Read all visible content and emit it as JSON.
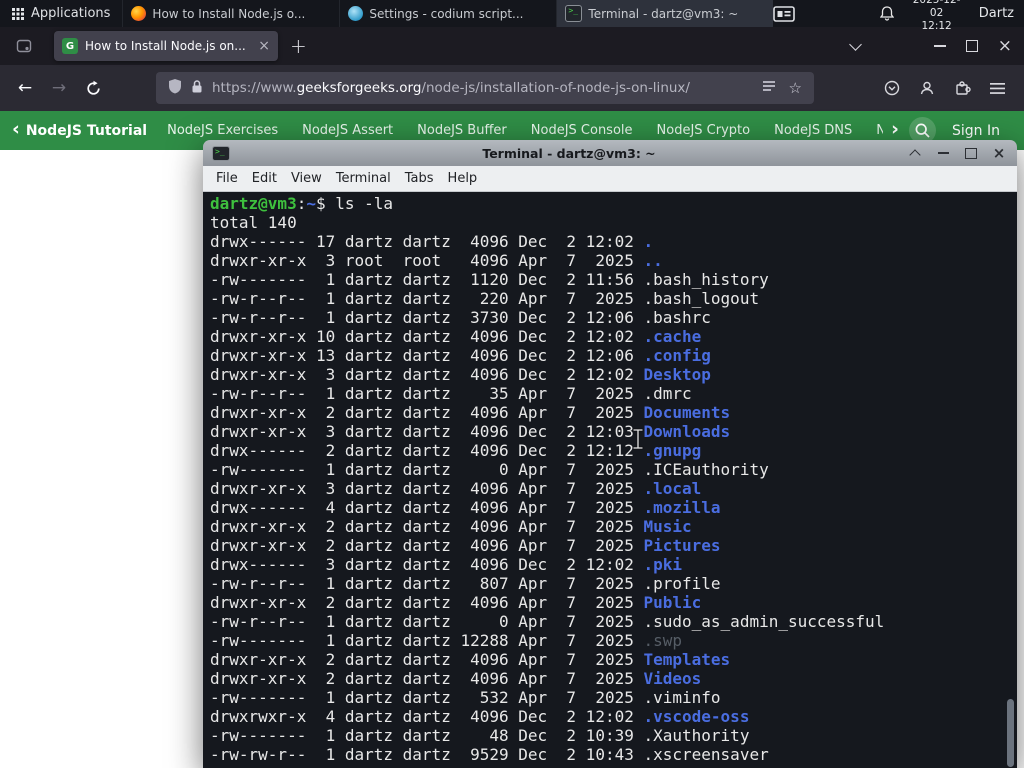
{
  "panel": {
    "applications_label": "Applications",
    "windows": [
      {
        "title": "How to Install Node.js o...",
        "icon": "firefox-icon",
        "active": false
      },
      {
        "title": "Settings - codium script...",
        "icon": "settings-icon",
        "active": false
      },
      {
        "title": "Terminal - dartz@vm3: ~",
        "icon": "terminal-icon",
        "active": true
      }
    ],
    "clock": {
      "date": "2025-12-02",
      "time": "12:12"
    },
    "user_label": "Dartz"
  },
  "glyphs": {
    "back": "←",
    "forward": "→",
    "close": "×",
    "plus": "+",
    "star": "☆",
    "nav_back": "‹",
    "nav_forward": "›",
    "favicon": "G"
  },
  "browser": {
    "tab": {
      "title": "How to Install Node.js on..."
    },
    "urlbar": {
      "scheme": "https://www.",
      "host": "geeksforgeeks.org",
      "path": "/node-js/installation-of-node-js-on-linux/",
      "full_url": "https://www.geeksforgeeks.org/node-js/installation-of-node-js-on-linux/"
    },
    "gfg_nav": {
      "active_item": "NodeJS Tutorial",
      "items": [
        "NodeJS Exercises",
        "NodeJS Assert",
        "NodeJS Buffer",
        "NodeJS Console",
        "NodeJS Crypto",
        "NodeJS DNS",
        "Node"
      ],
      "sign_in_label": "Sign In"
    }
  },
  "terminal": {
    "window_title": "Terminal - dartz@vm3: ~",
    "menu_items": [
      "File",
      "Edit",
      "View",
      "Terminal",
      "Tabs",
      "Help"
    ],
    "output": [
      {
        "segs": [
          {
            "t": "dartz@vm3",
            "c": "g"
          },
          {
            "t": ":"
          },
          {
            "t": "~",
            "c": "b"
          },
          {
            "t": "$ "
          },
          {
            "t": "ls -la"
          }
        ]
      },
      {
        "segs": [
          {
            "t": "total 140"
          }
        ]
      },
      {
        "segs": [
          {
            "t": "drwx------ 17 dartz dartz  4096 Dec  2 12:02 "
          },
          {
            "t": ".",
            "c": "b"
          }
        ]
      },
      {
        "segs": [
          {
            "t": "drwxr-xr-x  3 root  root   4096 Apr  7  2025 "
          },
          {
            "t": "..",
            "c": "b"
          }
        ]
      },
      {
        "segs": [
          {
            "t": "-rw-------  1 dartz dartz  1120 Dec  2 11:56 "
          },
          {
            "t": ".bash_history"
          }
        ]
      },
      {
        "segs": [
          {
            "t": "-rw-r--r--  1 dartz dartz   220 Apr  7  2025 "
          },
          {
            "t": ".bash_logout"
          }
        ]
      },
      {
        "segs": [
          {
            "t": "-rw-r--r--  1 dartz dartz  3730 Dec  2 12:06 "
          },
          {
            "t": ".bashrc"
          }
        ]
      },
      {
        "segs": [
          {
            "t": "drwxr-xr-x 10 dartz dartz  4096 Dec  2 12:02 "
          },
          {
            "t": ".cache",
            "c": "b"
          }
        ]
      },
      {
        "segs": [
          {
            "t": "drwxr-xr-x 13 dartz dartz  4096 Dec  2 12:06 "
          },
          {
            "t": ".config",
            "c": "b"
          }
        ]
      },
      {
        "segs": [
          {
            "t": "drwxr-xr-x  3 dartz dartz  4096 Dec  2 12:02 "
          },
          {
            "t": "Desktop",
            "c": "b"
          }
        ]
      },
      {
        "segs": [
          {
            "t": "-rw-r--r--  1 dartz dartz    35 Apr  7  2025 "
          },
          {
            "t": ".dmrc"
          }
        ]
      },
      {
        "segs": [
          {
            "t": "drwxr-xr-x  2 dartz dartz  4096 Apr  7  2025 "
          },
          {
            "t": "Documents",
            "c": "b"
          }
        ]
      },
      {
        "segs": [
          {
            "t": "drwxr-xr-x  3 dartz dartz  4096 Dec  2 12:03 "
          },
          {
            "t": "Downloads",
            "c": "b"
          }
        ]
      },
      {
        "segs": [
          {
            "t": "drwx------  2 dartz dartz  4096 Dec  2 12:12 "
          },
          {
            "t": ".gnupg",
            "c": "b"
          }
        ]
      },
      {
        "segs": [
          {
            "t": "-rw-------  1 dartz dartz     0 Apr  7  2025 "
          },
          {
            "t": ".ICEauthority"
          }
        ]
      },
      {
        "segs": [
          {
            "t": "drwxr-xr-x  3 dartz dartz  4096 Apr  7  2025 "
          },
          {
            "t": ".local",
            "c": "b"
          }
        ]
      },
      {
        "segs": [
          {
            "t": "drwx------  4 dartz dartz  4096 Apr  7  2025 "
          },
          {
            "t": ".mozilla",
            "c": "b"
          }
        ]
      },
      {
        "segs": [
          {
            "t": "drwxr-xr-x  2 dartz dartz  4096 Apr  7  2025 "
          },
          {
            "t": "Music",
            "c": "b"
          }
        ]
      },
      {
        "segs": [
          {
            "t": "drwxr-xr-x  2 dartz dartz  4096 Apr  7  2025 "
          },
          {
            "t": "Pictures",
            "c": "b"
          }
        ]
      },
      {
        "segs": [
          {
            "t": "drwx------  3 dartz dartz  4096 Dec  2 12:02 "
          },
          {
            "t": ".pki",
            "c": "b"
          }
        ]
      },
      {
        "segs": [
          {
            "t": "-rw-r--r--  1 dartz dartz   807 Apr  7  2025 "
          },
          {
            "t": ".profile"
          }
        ]
      },
      {
        "segs": [
          {
            "t": "drwxr-xr-x  2 dartz dartz  4096 Apr  7  2025 "
          },
          {
            "t": "Public",
            "c": "b"
          }
        ]
      },
      {
        "segs": [
          {
            "t": "-rw-r--r--  1 dartz dartz     0 Apr  7  2025 "
          },
          {
            "t": ".sudo_as_admin_successful"
          }
        ]
      },
      {
        "segs": [
          {
            "t": "-rw-------  1 dartz dartz 12288 Apr  7  2025 "
          },
          {
            "t": ".swp",
            "c": "d"
          }
        ]
      },
      {
        "segs": [
          {
            "t": "drwxr-xr-x  2 dartz dartz  4096 Apr  7  2025 "
          },
          {
            "t": "Templates",
            "c": "b"
          }
        ]
      },
      {
        "segs": [
          {
            "t": "drwxr-xr-x  2 dartz dartz  4096 Apr  7  2025 "
          },
          {
            "t": "Videos",
            "c": "b"
          }
        ]
      },
      {
        "segs": [
          {
            "t": "-rw-------  1 dartz dartz   532 Apr  7  2025 "
          },
          {
            "t": ".viminfo"
          }
        ]
      },
      {
        "segs": [
          {
            "t": "drwxrwxr-x  4 dartz dartz  4096 Dec  2 12:02 "
          },
          {
            "t": ".vscode-oss",
            "c": "b"
          }
        ]
      },
      {
        "segs": [
          {
            "t": "-rw-------  1 dartz dartz    48 Dec  2 10:39 "
          },
          {
            "t": ".Xauthority"
          }
        ]
      },
      {
        "segs": [
          {
            "t": "-rw-rw-r--  1 dartz dartz  9529 Dec  2 10:43 "
          },
          {
            "t": ".xscreensaver"
          }
        ]
      }
    ]
  },
  "colors": {
    "panel_bg": "#14161c",
    "browser_chrome_bg": "#2b2a33",
    "tab_bg": "#42414d",
    "gfg_green": "#2f8d46",
    "terminal_bg": "#15181e",
    "dir_blue": "#4a6de0",
    "prompt_green": "#3ec03e",
    "dim_gray": "#565d66"
  }
}
